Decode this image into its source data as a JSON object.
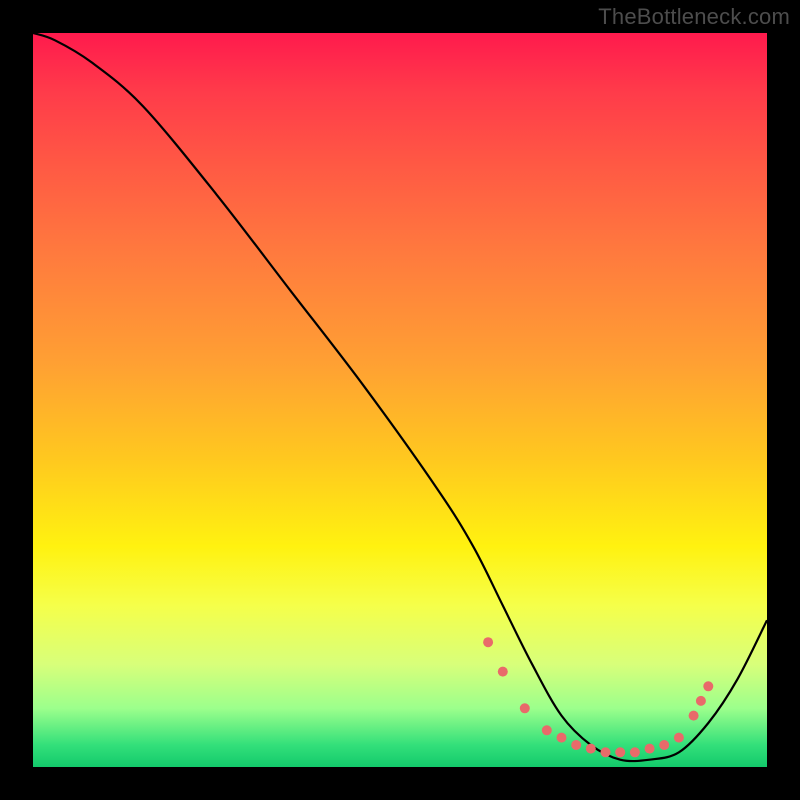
{
  "watermark": "TheBottleneck.com",
  "chart_data": {
    "type": "line",
    "title": "",
    "xlabel": "",
    "ylabel": "",
    "xlim": [
      0,
      100
    ],
    "ylim": [
      0,
      100
    ],
    "series": [
      {
        "name": "curve",
        "x": [
          0,
          3,
          8,
          15,
          25,
          35,
          45,
          55,
          60,
          64,
          68,
          72,
          76,
          80,
          84,
          88,
          92,
          96,
          100
        ],
        "values": [
          100,
          99,
          96,
          90,
          78,
          65,
          52,
          38,
          30,
          22,
          14,
          7,
          3,
          1,
          1,
          2,
          6,
          12,
          20
        ]
      }
    ],
    "markers": {
      "name": "dots",
      "color": "#e96a6a",
      "points_x": [
        62,
        64,
        67,
        70,
        72,
        74,
        76,
        78,
        80,
        82,
        84,
        86,
        88,
        90,
        91,
        92
      ],
      "points_y": [
        17,
        13,
        8,
        5,
        4,
        3,
        2.5,
        2,
        2,
        2,
        2.5,
        3,
        4,
        7,
        9,
        11
      ]
    },
    "gradient_stops": [
      {
        "pct": 0,
        "color": "#ff1a4d"
      },
      {
        "pct": 18,
        "color": "#ff5944"
      },
      {
        "pct": 45,
        "color": "#ffa033"
      },
      {
        "pct": 70,
        "color": "#fff210"
      },
      {
        "pct": 92,
        "color": "#9cff8c"
      },
      {
        "pct": 100,
        "color": "#13c96b"
      }
    ]
  }
}
